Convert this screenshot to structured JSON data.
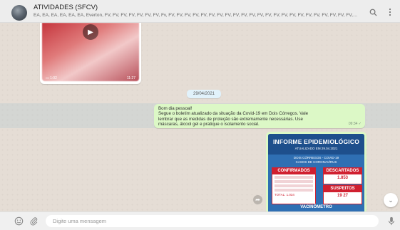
{
  "header": {
    "title": "ATIVIDADES (SFCV)",
    "participants": "EA, EA, EA, EA, EA, EA, Everton, FV, FV, FV, FV, FV, FV, FV, Fv, FV, FV, FV, FV, FV, FV, FV, FV, FV, FV, FV, FV, FV, FV, FV, FV, FV, FV, FV, FV, FV, FV, FV, ...",
    "search_icon": "search-icon",
    "menu_icon": "more-vertical-icon"
  },
  "chat": {
    "video": {
      "meta": "▭ 1:02",
      "time": "11:27",
      "play_icon": "play-icon"
    },
    "date_chip": "29/04/2021",
    "message": {
      "lines": [
        "Bom dia pessoal!",
        "Segue o boletim atualizado da situação da Covid-19 em Dois Córregos. Vale",
        "lembrar que as medidas de proteção são extremamente necessárias. Use",
        "máscaras, álcool gel e pratique o isolamento social."
      ],
      "time": "09:34 ✓"
    },
    "image": {
      "title": "INFORME EPIDEMIOLÓGICO",
      "updated": "ATUALIZADO EM 29.04.2021",
      "line1": "DOIS CÓRREGOS - COVID-19",
      "line2": "CASOS DE CORONAVÍRUS",
      "confirmados": "CONFIRMADOS",
      "descartados": "DESCARTADOS",
      "descartados_value": "1.853",
      "suspeitos": "SUSPEITOS",
      "suspeitos_values": "19   27",
      "total": "TOTAL: 1.034",
      "footer": "VACINÔMETRO"
    }
  },
  "composer": {
    "placeholder": "Digite uma mensagem",
    "emoji_icon": "emoji-icon",
    "attach_icon": "paperclip-icon",
    "mic_icon": "microphone-icon"
  }
}
